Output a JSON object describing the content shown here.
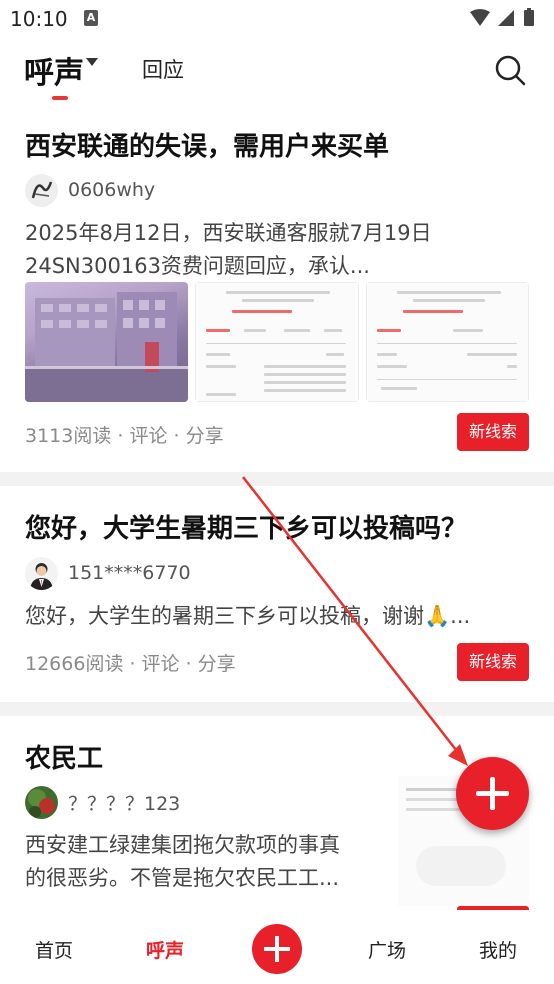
{
  "status_bar": {
    "time": "10:10",
    "notification_letter": "A"
  },
  "top_nav": {
    "tabs": [
      "呼声",
      "回应"
    ]
  },
  "posts": [
    {
      "title": "西安联通的失误，需用户来买单",
      "author": "0606why",
      "excerpt_line1": "2025年8月12日，西安联通客服就7月19日",
      "excerpt_line2": "24SN300163资费问题回应，承认...",
      "meta": "3113阅读 · 评论 · 分享",
      "button": "新线索"
    },
    {
      "title": "您好，大学生暑期三下乡可以投稿吗？",
      "author": "151****6770",
      "excerpt_line1": "您好，大学生的暑期三下乡可以投稿，谢谢🙏...",
      "meta": "12666阅读 · 评论 · 分享",
      "button": "新线索"
    },
    {
      "title": "农民工",
      "author": "？？？？123",
      "excerpt_line1": "西安建工绿建集团拖欠款项的事真",
      "excerpt_line2": "的很恶劣。不管是拖欠农民工工..."
    }
  ],
  "bottom_nav": {
    "items": [
      "首页",
      "呼声",
      "广场",
      "我的"
    ],
    "active": "呼声"
  },
  "colors": {
    "accent": "#e8202a"
  },
  "icons": [
    "wifi-icon",
    "signal-icon",
    "battery-icon",
    "search-icon",
    "plus-icon",
    "annotation-arrow"
  ]
}
